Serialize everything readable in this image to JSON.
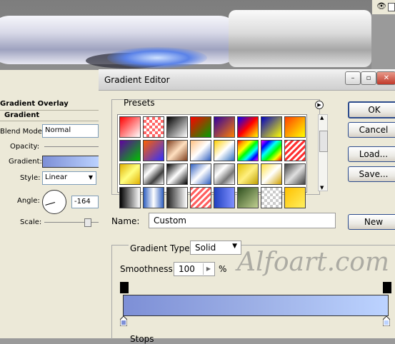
{
  "canvas": {},
  "layer_style": {
    "section": "Gradient Overlay",
    "subsection": "Gradient",
    "blend_mode_label": "Blend Mode:",
    "blend_mode_value": "Normal",
    "opacity_label": "Opacity:",
    "gradient_label": "Gradient:",
    "style_label": "Style:",
    "style_value": "Linear",
    "angle_label": "Angle:",
    "angle_value": "-164",
    "scale_label": "Scale:"
  },
  "dialog": {
    "title": "Gradient Editor",
    "presets_label": "Presets",
    "buttons": {
      "ok": "OK",
      "cancel": "Cancel",
      "load": "Load...",
      "save": "Save...",
      "new": "New"
    },
    "name_label": "Name:",
    "name_value": "Custom",
    "gradient_type_label": "Gradient Type:",
    "gradient_type_value": "Solid",
    "smoothness_label": "Smoothness:",
    "smoothness_value": "100",
    "smoothness_unit": "%",
    "stops_label": "Stops",
    "watermark": "Alfoart.com"
  },
  "colors": {
    "gradient_start": "#7d8fd6",
    "gradient_end": "#bcd3ff"
  },
  "presets": [
    "linear-gradient(135deg,#ff0000,#ffffff)",
    "repeating-conic-gradient(#ff6666 0 25%,#fff 0 50%) 0 0/8px 8px",
    "linear-gradient(135deg,#000,#fff)",
    "linear-gradient(135deg,#ff0000,#00a000)",
    "linear-gradient(135deg,#3000a0,#ff8000)",
    "linear-gradient(135deg,#0000ff,#ff0000,#ffff00)",
    "linear-gradient(135deg,#0000c0,#ffff00)",
    "linear-gradient(135deg,#ff4000,#ffff00)",
    "linear-gradient(135deg,#6000a0,#00c000)",
    "linear-gradient(135deg,#ff6000,#3030ff)",
    "linear-gradient(135deg,#804020,#ffe0c0,#804020)",
    "linear-gradient(135deg,#ffc080,#fff,#3060c0)",
    "linear-gradient(135deg,#ffd000,#fff,#3070c0)",
    "linear-gradient(135deg,red,orange,yellow,lime,cyan,blue,magenta)",
    "linear-gradient(135deg,magenta,blue,cyan,lime,yellow,red)",
    "repeating-linear-gradient(135deg,#ff3030 0 3px,#fff 3px 6px)",
    "linear-gradient(135deg,#e0b000,#ffff80,#e0b000)",
    "linear-gradient(135deg,#808080,#fff,#404040,#fff)",
    "linear-gradient(135deg,#000,#fff,#000)",
    "linear-gradient(135deg,#3060c0,#fff,#3060c0)",
    "linear-gradient(135deg,#aaa,#fff,#777,#fff)",
    "linear-gradient(135deg,#e0c000,#fff080,#c0a000)",
    "linear-gradient(135deg,#ffe040,#fff,#d0a000)",
    "linear-gradient(135deg,#404040,#e0e0e0,#404040)",
    "linear-gradient(90deg,#000,#fff)",
    "linear-gradient(90deg,#3060c0,#ffffff,#3060c0)",
    "linear-gradient(90deg,#222,#fff)",
    "repeating-linear-gradient(135deg,#ff6060 0 3px,#fff 3px 6px)",
    "linear-gradient(90deg,#2040c0,#8090ff)",
    "linear-gradient(135deg,#305020,#c0d090)",
    "repeating-conic-gradient(#ccc 0 25%,#fff 0 50%) 0 0/8px 8px",
    "linear-gradient(135deg,#ffc000,#fff060)"
  ]
}
